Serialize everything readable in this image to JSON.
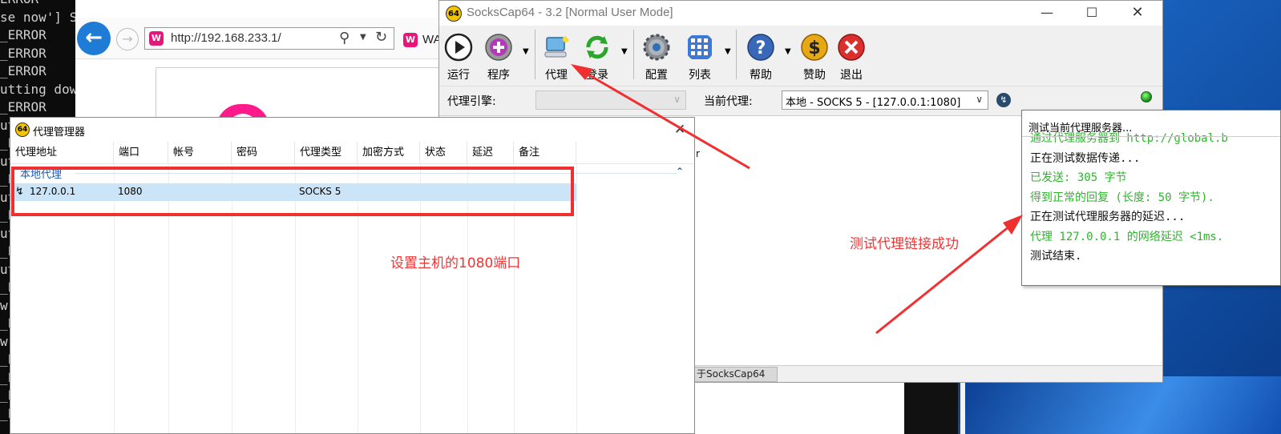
{
  "console": {
    "lines": [
      "ERROR",
      "se now'] S",
      "_ERROR",
      "_ERROR",
      "_ERROR",
      "utting dow",
      "_ERROR",
      "ut",
      "_E",
      "ut",
      "_E",
      "ut",
      "_E",
      "ut",
      "_E",
      "ut",
      "_E",
      "w'",
      "_E",
      "w'",
      "_E",
      "_E",
      "_E",
      "_E"
    ]
  },
  "browser": {
    "url": "http://192.168.233.1/",
    "tab_label": "WA",
    "favicon_letter": "W",
    "back_icon": "arrow-left-icon",
    "forward_icon": "arrow-right-icon"
  },
  "sockscap": {
    "title": "SocksCap64 - 3.2 [Normal User Mode]",
    "icon_text": "64",
    "toolbar": [
      {
        "id": "run",
        "label": "运行",
        "icon": "play-icon"
      },
      {
        "id": "program",
        "label": "程序",
        "icon": "add-program-icon"
      },
      {
        "id": "proxy",
        "label": "代理",
        "icon": "proxy-icon"
      },
      {
        "id": "login",
        "label": "登录",
        "icon": "refresh-login-icon"
      },
      {
        "id": "config",
        "label": "配置",
        "icon": "gear-icon"
      },
      {
        "id": "list",
        "label": "列表",
        "icon": "grid-icon"
      },
      {
        "id": "help",
        "label": "帮助",
        "icon": "help-icon"
      },
      {
        "id": "donate",
        "label": "赞助",
        "icon": "dollar-icon"
      },
      {
        "id": "exit",
        "label": "退出",
        "icon": "close-icon"
      }
    ],
    "engine_label": "代理引擎:",
    "engine_value": "",
    "current_label": "当前代理:",
    "current_value": "本地 - SOCKS 5 - [127.0.0.1:1080]",
    "status_text": "于SocksCap64",
    "content_fragment": "r"
  },
  "proxy_manager": {
    "title": "代理管理器",
    "icon_text": "64",
    "columns": [
      "代理地址",
      "端口",
      "帐号",
      "密码",
      "代理类型",
      "加密方式",
      "状态",
      "延迟",
      "备注"
    ],
    "group": "本地代理",
    "rows": [
      {
        "address": "127.0.0.1",
        "port": "1080",
        "account": "",
        "password": "",
        "type": "SOCKS 5",
        "encryption": "",
        "status": "",
        "latency": "",
        "note": ""
      }
    ]
  },
  "annotations": {
    "port_note": "设置主机的1080端口",
    "success_note": "测试代理链接成功"
  },
  "popup": {
    "title": "测试当前代理服务器...",
    "log": [
      {
        "text": "通过代理服务器到 http://global.b",
        "color": "#2cb52c"
      },
      {
        "text": "正在测试数据传递...",
        "color": "#111111"
      },
      {
        "text": "已发送: 305 字节",
        "color": "#2cb52c"
      },
      {
        "text": "得到正常的回复 (长度: 50 字节).",
        "color": "#2cb52c"
      },
      {
        "text": "正在测试代理服务器的延迟...",
        "color": "#111111"
      },
      {
        "text": "代理 127.0.0.1 的网络延迟 <1ms.",
        "color": "#2cb52c"
      },
      {
        "text": "测试结束.",
        "color": "#111111"
      }
    ]
  },
  "colors": {
    "annotation_red": "#f03030",
    "selection_blue": "#cce4f7",
    "success_green": "#2cb52c"
  }
}
